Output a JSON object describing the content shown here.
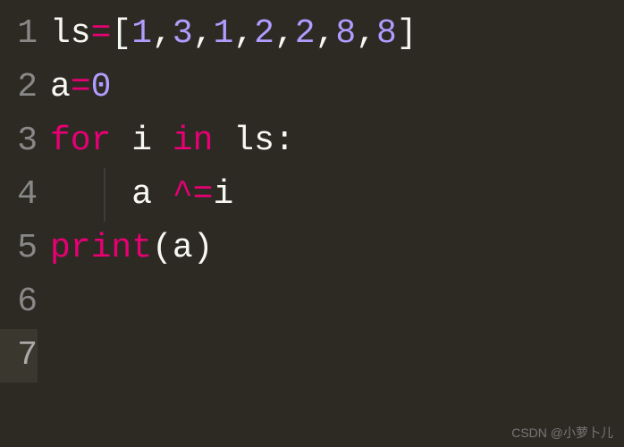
{
  "lineNumbers": [
    "1",
    "2",
    "3",
    "4",
    "5",
    "6",
    "7"
  ],
  "currentLine": 7,
  "code": {
    "l1": {
      "var1": "ls",
      "eq": "=",
      "lb": "[",
      "n1": "1",
      "c1": ",",
      "n2": "3",
      "c2": ",",
      "n3": "1",
      "c3": ",",
      "n4": "2",
      "c4": ",",
      "n5": "2",
      "c5": ",",
      "n6": "8",
      "c6": ",",
      "n7": "8",
      "rb": "]"
    },
    "l2": {
      "var": "a",
      "eq": "=",
      "n": "0"
    },
    "l3": {
      "kfor": "for",
      "sp1": " ",
      "i": "i",
      "sp2": " ",
      "kin": "in",
      "sp3": " ",
      "ls": "ls",
      "colon": ":"
    },
    "l4": {
      "indent": "    ",
      "a": "a",
      "sp": " ",
      "op": "^=",
      "i": "i"
    },
    "l5": {
      "fn": "print",
      "lp": "(",
      "a": "a",
      "rp": ")"
    }
  },
  "watermark": "CSDN @小萝卜儿"
}
